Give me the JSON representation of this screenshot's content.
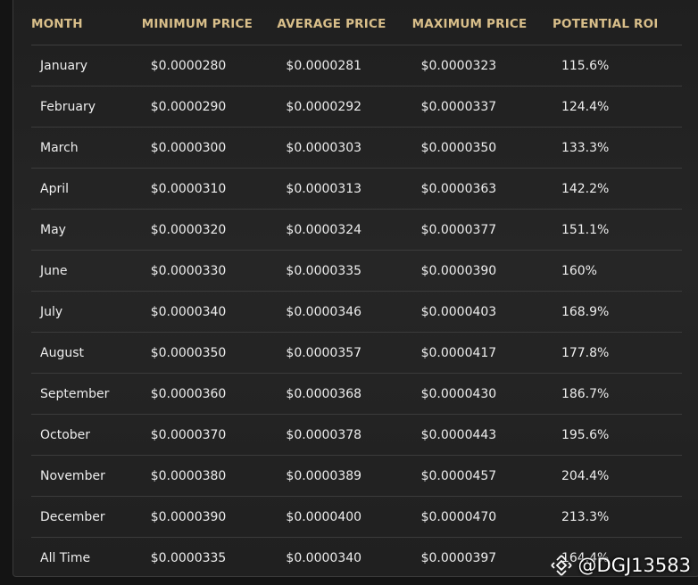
{
  "table": {
    "headers": [
      "MONTH",
      "MINIMUM PRICE",
      "AVERAGE PRICE",
      "MAXIMUM PRICE",
      "POTENTIAL ROI"
    ],
    "rows": [
      [
        "January",
        "$0.0000280",
        "$0.0000281",
        "$0.0000323",
        "115.6%"
      ],
      [
        "February",
        "$0.0000290",
        "$0.0000292",
        "$0.0000337",
        "124.4%"
      ],
      [
        "March",
        "$0.0000300",
        "$0.0000303",
        "$0.0000350",
        "133.3%"
      ],
      [
        "April",
        "$0.0000310",
        "$0.0000313",
        "$0.0000363",
        "142.2%"
      ],
      [
        "May",
        "$0.0000320",
        "$0.0000324",
        "$0.0000377",
        "151.1%"
      ],
      [
        "June",
        "$0.0000330",
        "$0.0000335",
        "$0.0000390",
        "160%"
      ],
      [
        "July",
        "$0.0000340",
        "$0.0000346",
        "$0.0000403",
        "168.9%"
      ],
      [
        "August",
        "$0.0000350",
        "$0.0000357",
        "$0.0000417",
        "177.8%"
      ],
      [
        "September",
        "$0.0000360",
        "$0.0000368",
        "$0.0000430",
        "186.7%"
      ],
      [
        "October",
        "$0.0000370",
        "$0.0000378",
        "$0.0000443",
        "195.6%"
      ],
      [
        "November",
        "$0.0000380",
        "$0.0000389",
        "$0.0000457",
        "204.4%"
      ],
      [
        "December",
        "$0.0000390",
        "$0.0000400",
        "$0.0000470",
        "213.3%"
      ],
      [
        "All Time",
        "$0.0000335",
        "$0.0000340",
        "$0.0000397",
        "164.4%"
      ]
    ]
  },
  "watermark": {
    "text": "@DGJ13583",
    "icon": "binance-logo-icon"
  },
  "colors": {
    "header_text": "#d9bf8a",
    "cell_text": "#ededed",
    "background": "#222222",
    "divider": "#3b3b3b"
  }
}
